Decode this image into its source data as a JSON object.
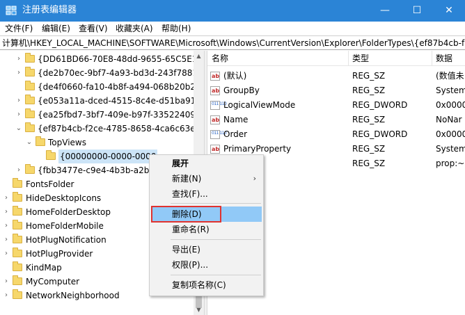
{
  "window": {
    "title": "注册表编辑器",
    "minimize_glyph": "—",
    "maximize_glyph": "☐",
    "close_glyph": "✕"
  },
  "menubar": {
    "items": [
      "文件(F)",
      "编辑(E)",
      "查看(V)",
      "收藏夹(A)",
      "帮助(H)"
    ]
  },
  "address": {
    "path": "计算机\\HKEY_LOCAL_MACHINE\\SOFTWARE\\Microsoft\\Windows\\CurrentVersion\\Explorer\\FolderTypes\\{ef87b4cb-f"
  },
  "tree": {
    "items": [
      {
        "label": "{DD61BD66-70E8-48dd-9655-65C5E1A",
        "expander": "›"
      },
      {
        "label": "{de2b70ec-9bf7-4a93-bd3d-243f7881",
        "expander": "›"
      },
      {
        "label": "{de4f0660-fa10-4b8f-a494-068b20b22",
        "expander": ""
      },
      {
        "label": "{e053a11a-dced-4515-8c4e-d51ba917",
        "expander": "›"
      },
      {
        "label": "{ea25fbd7-3bf7-409e-b97f-335224090",
        "expander": "›"
      },
      {
        "label": "{ef87b4cb-f2ce-4785-8658-4ca6c63e3",
        "expander": "⌄"
      },
      {
        "label": "TopViews",
        "expander": "⌄"
      },
      {
        "label": "{00000000-0000-0000",
        "expander": ""
      },
      {
        "label": "{fbb3477e-c9e4-4b3b-a2ba",
        "expander": "›"
      },
      {
        "label": "FontsFolder",
        "expander": ""
      },
      {
        "label": "HideDesktopIcons",
        "expander": "›"
      },
      {
        "label": "HomeFolderDesktop",
        "expander": "›"
      },
      {
        "label": "HomeFolderMobile",
        "expander": "›"
      },
      {
        "label": "HotPlugNotification",
        "expander": "›"
      },
      {
        "label": "HotPlugProvider",
        "expander": "›"
      },
      {
        "label": "KindMap",
        "expander": ""
      },
      {
        "label": "MyComputer",
        "expander": "›"
      },
      {
        "label": "NetworkNeighborhood",
        "expander": "›"
      }
    ]
  },
  "list": {
    "columns": [
      "名称",
      "类型",
      "数据"
    ],
    "rows": [
      {
        "icon": "string-value-icon",
        "icon_text": "ab",
        "name": "(默认)",
        "type": "REG_SZ",
        "data": "(数值未"
      },
      {
        "icon": "string-value-icon",
        "icon_text": "ab",
        "name": "GroupBy",
        "type": "REG_SZ",
        "data": "System"
      },
      {
        "icon": "dword-value-icon",
        "icon_text": "011 110",
        "name": "LogicalViewMode",
        "type": "REG_DWORD",
        "data": "0x0000"
      },
      {
        "icon": "string-value-icon",
        "icon_text": "ab",
        "name": "Name",
        "type": "REG_SZ",
        "data": "NoNar"
      },
      {
        "icon": "dword-value-icon",
        "icon_text": "011 110",
        "name": "Order",
        "type": "REG_DWORD",
        "data": "0x0000"
      },
      {
        "icon": "string-value-icon",
        "icon_text": "ab",
        "name": "PrimaryProperty",
        "type": "REG_SZ",
        "data": "System"
      },
      {
        "icon": "",
        "icon_text": "",
        "name": "",
        "type": "REG_SZ",
        "data": "prop:~S"
      }
    ]
  },
  "context_menu": {
    "items": [
      {
        "label": "展开",
        "bold": true,
        "submenu": ""
      },
      {
        "label": "新建(N)",
        "bold": false,
        "submenu": "›"
      },
      {
        "label": "查找(F)...",
        "bold": false,
        "submenu": ""
      },
      {
        "label": "删除(D)",
        "bold": false,
        "submenu": "",
        "highlighted": true
      },
      {
        "label": "重命名(R)",
        "bold": false,
        "submenu": ""
      },
      {
        "label": "导出(E)",
        "bold": false,
        "submenu": ""
      },
      {
        "label": "权限(P)...",
        "bold": false,
        "submenu": ""
      },
      {
        "label": "复制项名称(C)",
        "bold": false,
        "submenu": ""
      }
    ]
  },
  "colors": {
    "titlebar": "#2b84d6",
    "selection": "#cce4f7",
    "menu_highlight": "#91c9f7",
    "annotation_box": "#e0322f"
  }
}
